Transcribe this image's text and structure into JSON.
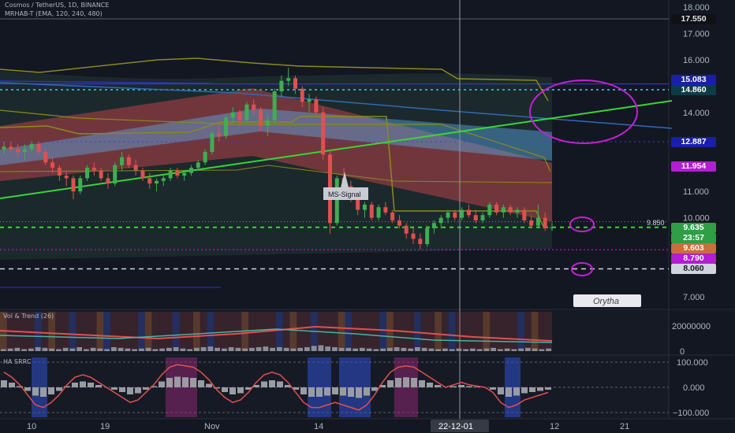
{
  "header": {
    "symbol_line": "Cosmos / TetherUS, 1D, BINANCE",
    "indicator_line": "MRHAB-T (EMA, 120, 240, 480)"
  },
  "price_axis": {
    "ticks": [
      "18.000",
      "17.000",
      "16.000",
      "14.000",
      "11.000",
      "10.000",
      "7.000"
    ]
  },
  "price_badges": [
    {
      "label": "17.550",
      "bg": "#0f1115",
      "fg": "#e0e3eb"
    },
    {
      "label": "15.083",
      "bg": "#1b1fa8",
      "fg": "#ffffff"
    },
    {
      "label": "14.860",
      "bg": "#0c3d46",
      "fg": "#ffffff"
    },
    {
      "label": "12.887",
      "bg": "#1b1fa8",
      "fg": "#ffffff"
    },
    {
      "label": "11.954",
      "bg": "#b21ed0",
      "fg": "#ffffff"
    },
    {
      "label": "9.635",
      "bg": "#2f9e45",
      "fg": "#ffffff"
    },
    {
      "label": "23:57",
      "bg": "#2f9e45",
      "fg": "#ffffff"
    },
    {
      "label": "9.603",
      "bg": "#c96e3c",
      "fg": "#ffffff"
    },
    {
      "label": "8.790",
      "bg": "#b21ed0",
      "fg": "#ffffff"
    },
    {
      "label": "8.060",
      "bg": "#d1d4dc",
      "fg": "#131722"
    }
  ],
  "line_label": "9.850",
  "ms_signal": "MS-Signal",
  "watermark": "Orytha",
  "vol_panel": {
    "title": "Vol & Trend (26)",
    "ticks": [
      "20000000",
      "0"
    ]
  },
  "osc_panel": {
    "title": "HA SRRC",
    "ticks": [
      "100.000",
      "0.000",
      "−100.000"
    ]
  },
  "time_axis": {
    "labels": [
      "10",
      "19",
      "Nov",
      "14",
      "22-12-01",
      "12",
      "21"
    ],
    "cursor_label": "22-12-01"
  },
  "colors": {
    "background": "#131722",
    "bull": "#3fae52",
    "bear": "#e0504f",
    "trendline": "#37d637",
    "magenta": "#c51fd6",
    "olive": "#8b8a1c",
    "blue_line": "#2f6ab5"
  },
  "chart_data": [
    {
      "type": "candlestick",
      "title": "Cosmos / TetherUS, 1D, BINANCE",
      "ylim": [
        6.6,
        18.3
      ],
      "x_labels": [
        "10",
        "19",
        "Nov",
        "14",
        "22-12-01",
        "12",
        "21"
      ],
      "candles_ohlc": [
        [
          12.6,
          12.9,
          12.4,
          12.7
        ],
        [
          12.7,
          12.9,
          12.5,
          12.6
        ],
        [
          12.6,
          12.8,
          12.3,
          12.5
        ],
        [
          12.5,
          12.8,
          12.2,
          12.6
        ],
        [
          12.6,
          12.9,
          12.5,
          12.8
        ],
        [
          12.8,
          12.9,
          12.4,
          12.5
        ],
        [
          12.5,
          12.6,
          12.0,
          12.1
        ],
        [
          12.1,
          12.3,
          11.7,
          11.9
        ],
        [
          11.9,
          12.0,
          11.4,
          11.6
        ],
        [
          11.6,
          11.8,
          11.2,
          11.5
        ],
        [
          11.5,
          11.6,
          10.7,
          11.0
        ],
        [
          11.0,
          11.6,
          10.9,
          11.5
        ],
        [
          11.5,
          12.0,
          11.4,
          11.9
        ],
        [
          11.9,
          12.1,
          11.6,
          11.8
        ],
        [
          11.8,
          11.9,
          11.4,
          11.5
        ],
        [
          11.5,
          11.7,
          11.1,
          11.3
        ],
        [
          11.3,
          12.1,
          11.2,
          12.0
        ],
        [
          12.0,
          12.5,
          11.8,
          12.3
        ],
        [
          12.3,
          12.4,
          11.9,
          12.0
        ],
        [
          12.0,
          12.2,
          11.6,
          11.8
        ],
        [
          11.8,
          11.9,
          11.4,
          11.5
        ],
        [
          11.5,
          11.7,
          11.1,
          11.3
        ],
        [
          11.3,
          11.5,
          11.0,
          11.4
        ],
        [
          11.4,
          11.6,
          11.2,
          11.5
        ],
        [
          11.5,
          11.9,
          11.4,
          11.8
        ],
        [
          11.8,
          11.9,
          11.5,
          11.6
        ],
        [
          11.6,
          11.8,
          11.4,
          11.7
        ],
        [
          11.7,
          12.0,
          11.6,
          11.9
        ],
        [
          11.9,
          12.2,
          11.8,
          12.1
        ],
        [
          12.1,
          12.6,
          12.0,
          12.5
        ],
        [
          12.5,
          13.3,
          12.4,
          13.2
        ],
        [
          13.2,
          13.6,
          12.9,
          13.1
        ],
        [
          13.1,
          13.9,
          13.0,
          13.8
        ],
        [
          13.8,
          14.2,
          13.6,
          14.0
        ],
        [
          14.0,
          14.1,
          13.5,
          13.7
        ],
        [
          13.7,
          14.4,
          13.6,
          14.3
        ],
        [
          14.3,
          14.5,
          13.9,
          14.1
        ],
        [
          14.1,
          14.2,
          13.3,
          13.5
        ],
        [
          13.5,
          13.9,
          13.1,
          13.7
        ],
        [
          13.7,
          14.9,
          13.6,
          14.8
        ],
        [
          14.8,
          15.4,
          14.6,
          15.2
        ],
        [
          15.2,
          15.7,
          15.0,
          15.3
        ],
        [
          15.3,
          15.4,
          14.7,
          14.9
        ],
        [
          14.9,
          15.0,
          14.2,
          14.4
        ],
        [
          14.4,
          14.7,
          14.0,
          14.5
        ],
        [
          14.5,
          14.6,
          13.9,
          14.0
        ],
        [
          14.0,
          14.2,
          12.2,
          12.4
        ],
        [
          12.4,
          12.6,
          9.4,
          9.8
        ],
        [
          9.8,
          11.6,
          9.7,
          11.5
        ],
        [
          11.5,
          11.9,
          11.0,
          11.2
        ],
        [
          11.2,
          11.4,
          10.6,
          10.8
        ],
        [
          10.8,
          11.0,
          10.1,
          10.3
        ],
        [
          10.3,
          10.6,
          10.0,
          10.5
        ],
        [
          10.5,
          10.6,
          9.9,
          10.0
        ],
        [
          10.0,
          10.5,
          9.9,
          10.4
        ],
        [
          10.4,
          10.6,
          10.1,
          10.2
        ],
        [
          10.2,
          10.3,
          9.8,
          9.9
        ],
        [
          9.9,
          10.1,
          9.6,
          9.7
        ],
        [
          9.7,
          9.8,
          9.2,
          9.4
        ],
        [
          9.4,
          9.6,
          9.0,
          9.2
        ],
        [
          9.2,
          9.4,
          8.8,
          9.0
        ],
        [
          9.0,
          9.7,
          8.9,
          9.6
        ],
        [
          9.6,
          9.9,
          9.4,
          9.8
        ],
        [
          9.8,
          10.1,
          9.6,
          10.0
        ],
        [
          10.0,
          10.3,
          9.8,
          10.2
        ],
        [
          10.2,
          10.3,
          9.9,
          10.0
        ],
        [
          10.0,
          10.4,
          9.9,
          10.3
        ],
        [
          10.3,
          10.5,
          10.0,
          10.1
        ],
        [
          10.1,
          10.3,
          9.8,
          9.9
        ],
        [
          9.9,
          10.2,
          9.8,
          10.1
        ],
        [
          10.1,
          10.6,
          10.0,
          10.5
        ],
        [
          10.5,
          10.6,
          10.1,
          10.2
        ],
        [
          10.2,
          10.5,
          10.0,
          10.4
        ],
        [
          10.4,
          10.5,
          10.1,
          10.2
        ],
        [
          10.2,
          10.4,
          10.0,
          10.3
        ],
        [
          10.3,
          10.4,
          9.8,
          9.9
        ],
        [
          9.9,
          10.1,
          9.6,
          9.7
        ],
        [
          9.7,
          10.5,
          9.6,
          10.0
        ],
        [
          10.0,
          10.2,
          9.5,
          9.6
        ],
        [
          9.6,
          9.8,
          9.5,
          9.635
        ]
      ],
      "price_levels": [
        17.55,
        15.083,
        14.86,
        12.887,
        11.954,
        9.85,
        9.635,
        9.603,
        8.79,
        8.06
      ],
      "annotations": [
        "MS-Signal"
      ]
    },
    {
      "type": "bar",
      "title": "Vol & Trend (26)",
      "ylim": [
        0,
        30000000
      ],
      "values": [
        3,
        4,
        5,
        3,
        4,
        6,
        5,
        4,
        3,
        5,
        4,
        6,
        3,
        5,
        4,
        3,
        6,
        5,
        4,
        3,
        4,
        5,
        3,
        4,
        5,
        6,
        4,
        3,
        5,
        6,
        7,
        5,
        4,
        6,
        5,
        4,
        5,
        6,
        7,
        5,
        6,
        5,
        4,
        5,
        6,
        8,
        9,
        7,
        6,
        5,
        5,
        4,
        5,
        4,
        3,
        4,
        5,
        6,
        5,
        4,
        6,
        5,
        4,
        3,
        4,
        3,
        4,
        3,
        4,
        3,
        4,
        5,
        3,
        4,
        3,
        4,
        5,
        4,
        3,
        4
      ]
    },
    {
      "type": "line",
      "title": "HA SRRC",
      "ylim": [
        -120,
        120
      ],
      "values": [
        60,
        40,
        10,
        -30,
        -70,
        -80,
        -60,
        -30,
        10,
        40,
        50,
        40,
        20,
        0,
        -20,
        -40,
        -60,
        -50,
        -20,
        10,
        50,
        80,
        90,
        85,
        80,
        60,
        30,
        -10,
        -40,
        -60,
        -50,
        -20,
        20,
        50,
        60,
        50,
        20,
        -20,
        -60,
        -80,
        -80,
        -70,
        -60,
        -70,
        -80,
        -90,
        -70,
        -30,
        20,
        60,
        80,
        85,
        80,
        60,
        40,
        20,
        0,
        10,
        20,
        10,
        5,
        0,
        -20,
        -60,
        -80,
        -70,
        -50,
        -40,
        -30,
        -20
      ]
    }
  ]
}
